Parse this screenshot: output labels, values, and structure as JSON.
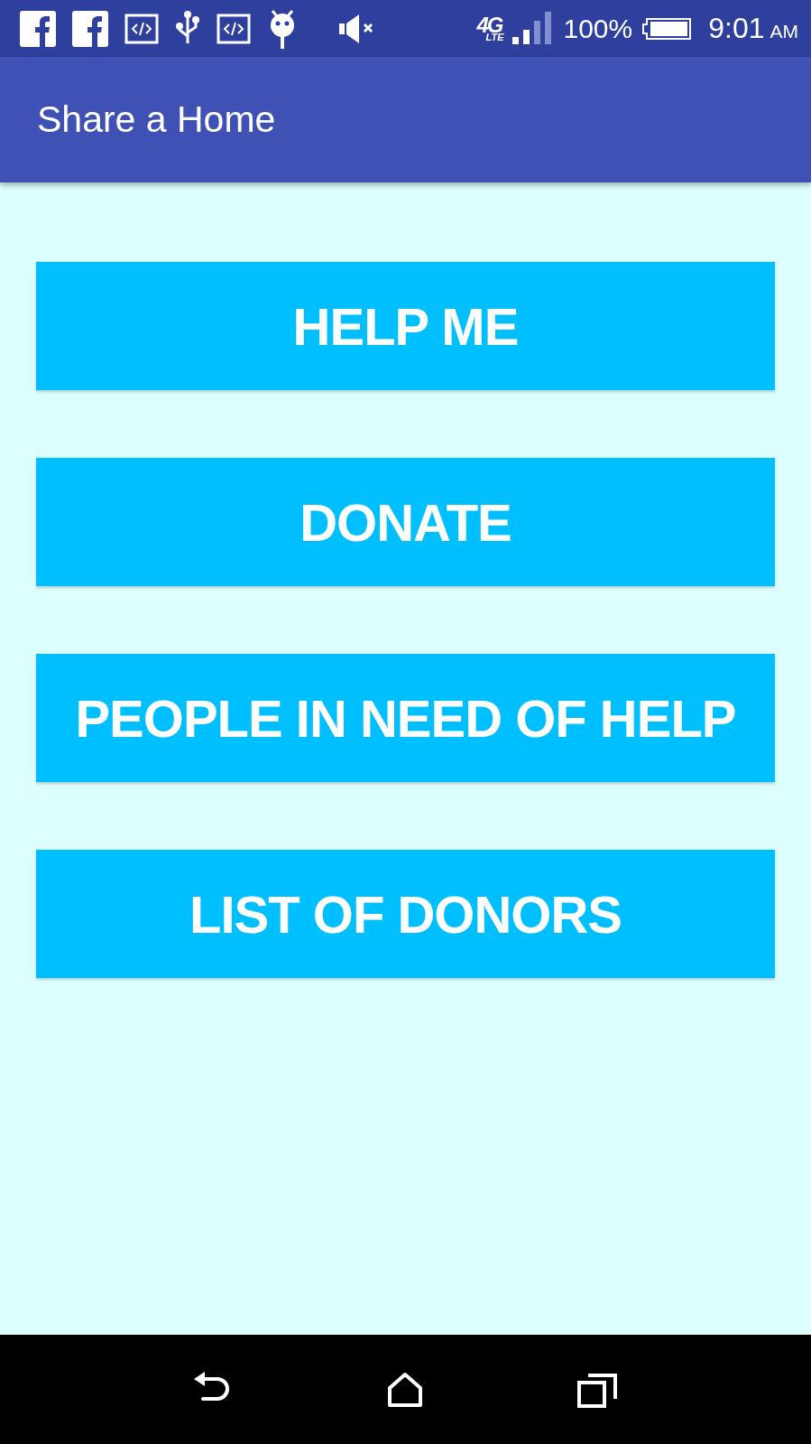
{
  "status_bar": {
    "network": "4G",
    "network_sub": "LTE",
    "battery": "100%",
    "time": "9:01",
    "meridiem": "AM"
  },
  "app_bar": {
    "title": "Share a Home"
  },
  "buttons": [
    {
      "label": "HELP ME"
    },
    {
      "label": "DONATE"
    },
    {
      "label": "PEOPLE IN NEED OF HELP"
    },
    {
      "label": "LIST OF DONORS"
    }
  ]
}
